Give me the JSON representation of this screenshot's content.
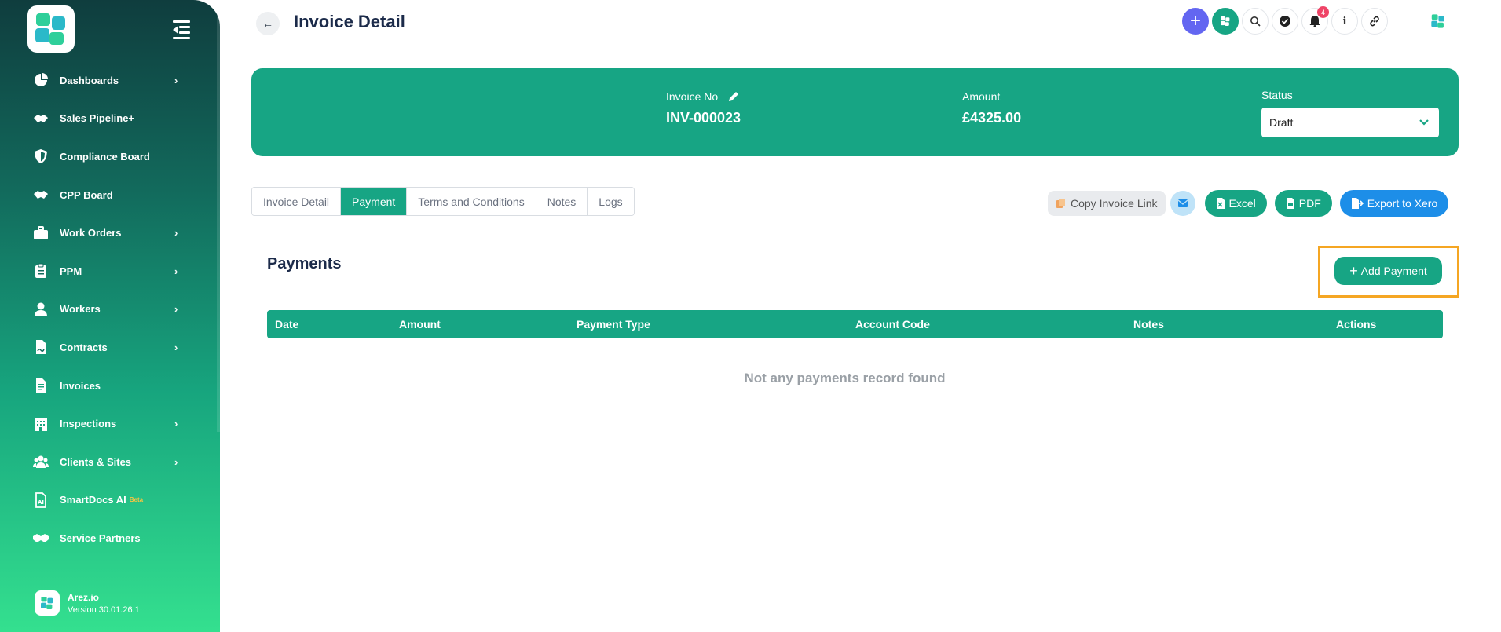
{
  "sidebar": {
    "items": [
      {
        "label": "Dashboards",
        "icon": "pie-chart-icon",
        "has_submenu": true
      },
      {
        "label": "Sales Pipeline+",
        "icon": "handshake-icon",
        "has_submenu": false
      },
      {
        "label": "Compliance Board",
        "icon": "shield-icon",
        "has_submenu": false
      },
      {
        "label": "CPP Board",
        "icon": "handshake-icon",
        "has_submenu": false
      },
      {
        "label": "Work Orders",
        "icon": "briefcase-icon",
        "has_submenu": true
      },
      {
        "label": "PPM",
        "icon": "clipboard-icon",
        "has_submenu": true
      },
      {
        "label": "Workers",
        "icon": "user-icon",
        "has_submenu": true
      },
      {
        "label": "Contracts",
        "icon": "contract-icon",
        "has_submenu": true
      },
      {
        "label": "Invoices",
        "icon": "document-icon",
        "has_submenu": false
      },
      {
        "label": "Inspections",
        "icon": "building-icon",
        "has_submenu": true
      },
      {
        "label": "Clients & Sites",
        "icon": "users-icon",
        "has_submenu": true
      },
      {
        "label": "SmartDocs AI",
        "badge": "Beta",
        "icon": "ai-document-icon",
        "has_submenu": false
      },
      {
        "label": "Service Partners",
        "icon": "partners-icon",
        "has_submenu": false
      }
    ],
    "footer": {
      "name": "Arez.io",
      "version": "Version 30.01.26.1"
    }
  },
  "header": {
    "title": "Invoice Detail",
    "notification_count": "4"
  },
  "invoice": {
    "no_label": "Invoice No",
    "no_value": "INV-000023",
    "amount_label": "Amount",
    "amount_value": "£4325.00",
    "status_label": "Status",
    "status_value": "Draft"
  },
  "tabs": [
    {
      "label": "Invoice Detail",
      "active": false
    },
    {
      "label": "Payment",
      "active": true
    },
    {
      "label": "Terms and Conditions",
      "active": false
    },
    {
      "label": "Notes",
      "active": false
    },
    {
      "label": "Logs",
      "active": false
    }
  ],
  "actions": {
    "copy_link": "Copy Invoice Link",
    "excel": "Excel",
    "pdf": "PDF",
    "xero": "Export to Xero"
  },
  "payments": {
    "title": "Payments",
    "add_label": "Add Payment",
    "columns": [
      "Date",
      "Amount",
      "Payment Type",
      "Account Code",
      "Notes",
      "Actions"
    ],
    "empty_message": "Not any payments record found"
  },
  "colors": {
    "primary": "#17a584",
    "accent_blue": "#1d8ee8",
    "accent_purple": "#6366f1",
    "highlight": "#f5a623",
    "badge_red": "#ef4467"
  }
}
